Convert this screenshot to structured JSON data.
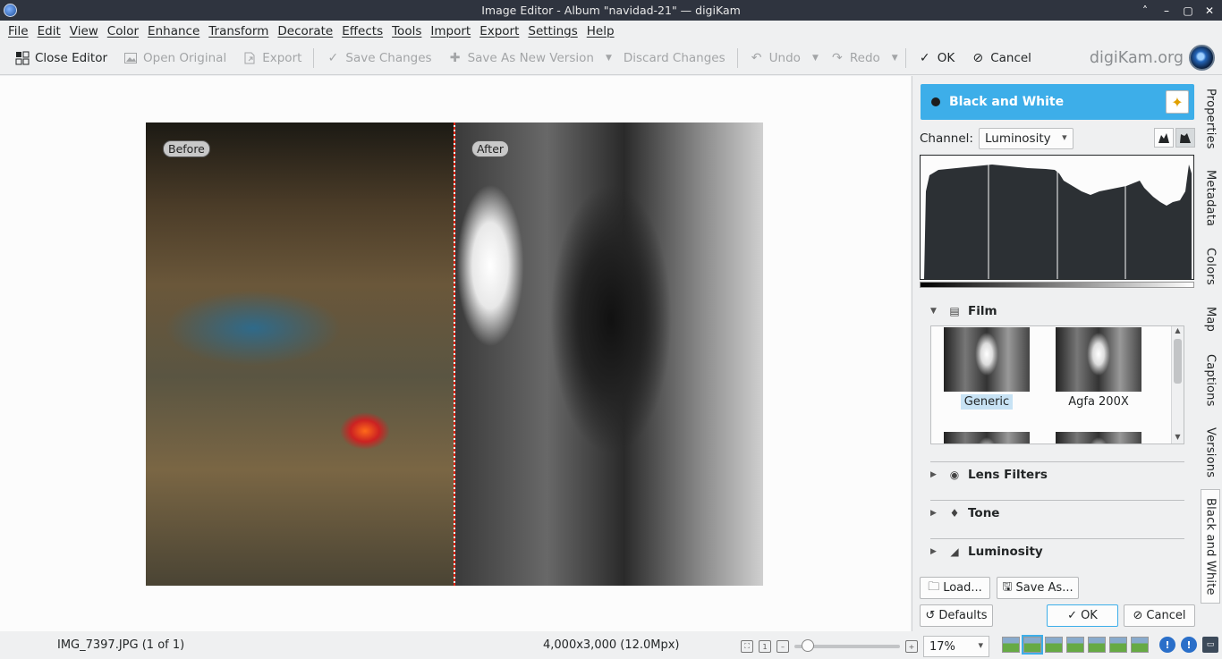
{
  "window": {
    "title": "Image Editor - Album \"navidad-21\" — digiKam",
    "controls": [
      "˄",
      "–",
      "▢",
      "✕"
    ]
  },
  "menu": [
    "File",
    "Edit",
    "View",
    "Color",
    "Enhance",
    "Transform",
    "Decorate",
    "Effects",
    "Tools",
    "Import",
    "Export",
    "Settings",
    "Help"
  ],
  "toolbar": {
    "close_editor": "Close Editor",
    "open_original": "Open Original",
    "export": "Export",
    "save_changes": "Save Changes",
    "save_as_new_version": "Save As New Version",
    "discard_changes": "Discard Changes",
    "undo": "Undo",
    "redo": "Redo",
    "ok": "OK",
    "cancel": "Cancel",
    "brand": "digiKam.org"
  },
  "canvas": {
    "before_label": "Before",
    "after_label": "After"
  },
  "tool": {
    "title": "Black and White",
    "channel_label": "Channel:",
    "channel_value": "Luminosity",
    "sections": {
      "film": "Film",
      "lens_filters": "Lens Filters",
      "tone": "Tone",
      "luminosity": "Luminosity"
    },
    "films": [
      "Generic",
      "Agfa 200X"
    ],
    "selected_film": "Generic",
    "buttons": {
      "load": "Load...",
      "save_as": "Save As...",
      "defaults": "Defaults",
      "ok": "OK",
      "cancel": "Cancel"
    }
  },
  "sidetabs": [
    "Properties",
    "Metadata",
    "Colors",
    "Map",
    "Captions",
    "Versions",
    "Black and White"
  ],
  "status": {
    "filename": "IMG_7397.JPG (1 of 1)",
    "dimensions": "4,000x3,000 (12.0Mpx)",
    "zoom": "17%"
  },
  "colors": {
    "accent": "#3daee9",
    "titlebar": "#2f343f",
    "background": "#eff0f1"
  }
}
